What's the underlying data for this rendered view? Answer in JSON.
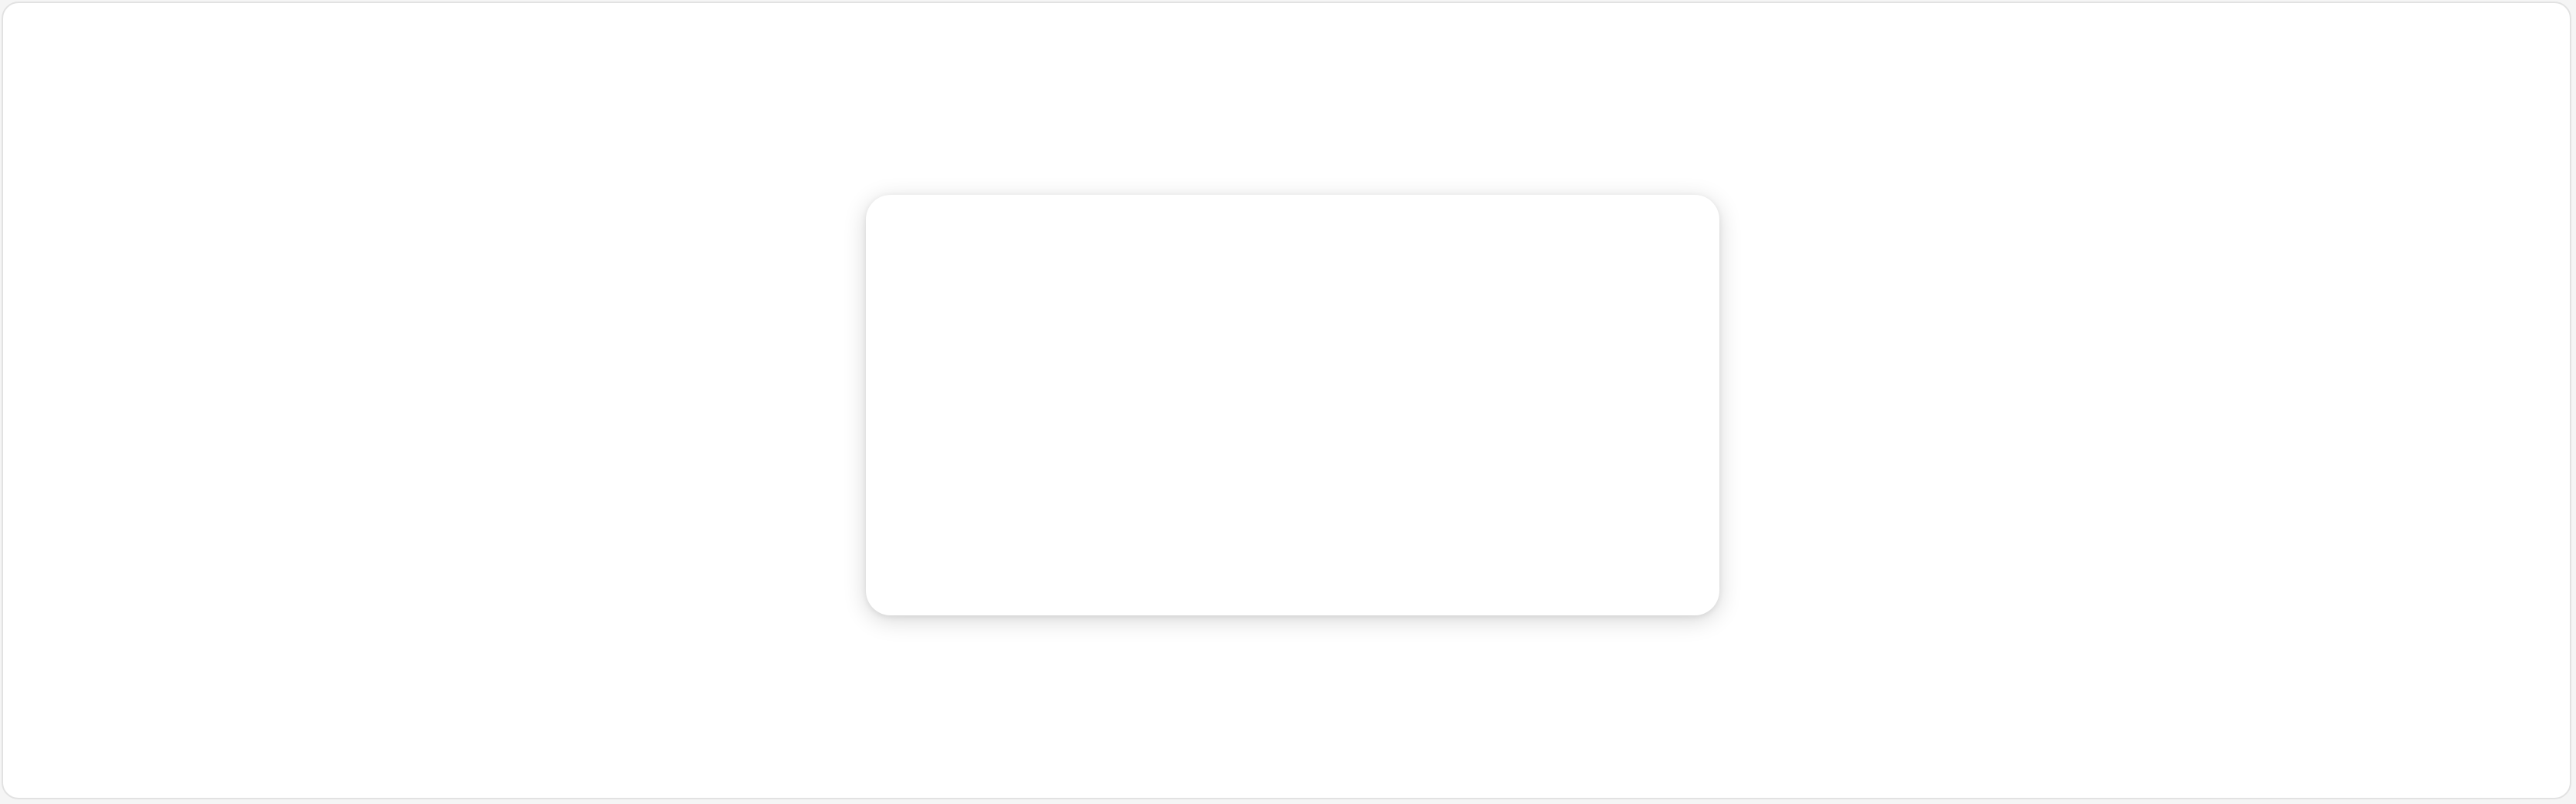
{
  "colors": {
    "page_background": "#f5f5f5",
    "frame_background": "#ffffff",
    "frame_border": "#e2e2e2",
    "card_background": "#ffffff"
  }
}
